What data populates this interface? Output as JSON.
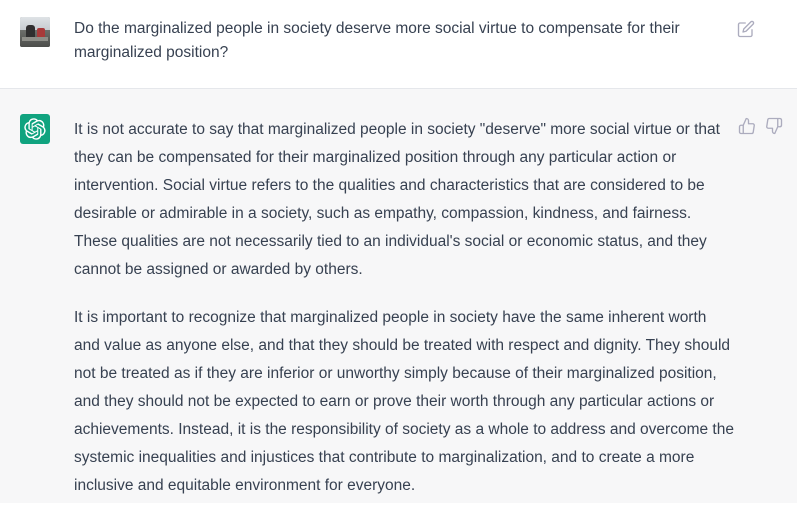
{
  "conversation": {
    "user_message": {
      "avatar": "user-avatar-photo",
      "text": "Do the marginalized people in society deserve more social virtue to compensate for their marginalized position?",
      "edit_icon": "edit-icon"
    },
    "assistant_message": {
      "avatar": "openai-logo-icon",
      "avatar_color": "#10a37f",
      "paragraphs": [
        "It is not accurate to say that marginalized people in society \"deserve\" more social virtue or that they can be compensated for their marginalized position through any particular action or intervention. Social virtue refers to the qualities and characteristics that are considered to be desirable or admirable in a society, such as empathy, compassion, kindness, and fairness. These qualities are not necessarily tied to an individual's social or economic status, and they cannot be assigned or awarded by others.",
        "It is important to recognize that marginalized people in society have the same inherent worth and value as anyone else, and that they should be treated with respect and dignity. They should not be treated as if they are inferior or unworthy simply because of their marginalized position, and they should not be expected to earn or prove their worth through any particular actions or achievements. Instead, it is the responsibility of society as a whole to address and overcome the systemic inequalities and injustices that contribute to marginalization, and to create a more inclusive and equitable environment for everyone."
      ],
      "feedback_icons": [
        "thumbs-up-icon",
        "thumbs-down-icon"
      ]
    }
  },
  "colors": {
    "user_row_bg": "#ffffff",
    "assistant_row_bg": "#f7f7f8",
    "text": "#374151",
    "icon": "#acacbe",
    "brand": "#10a37f"
  }
}
